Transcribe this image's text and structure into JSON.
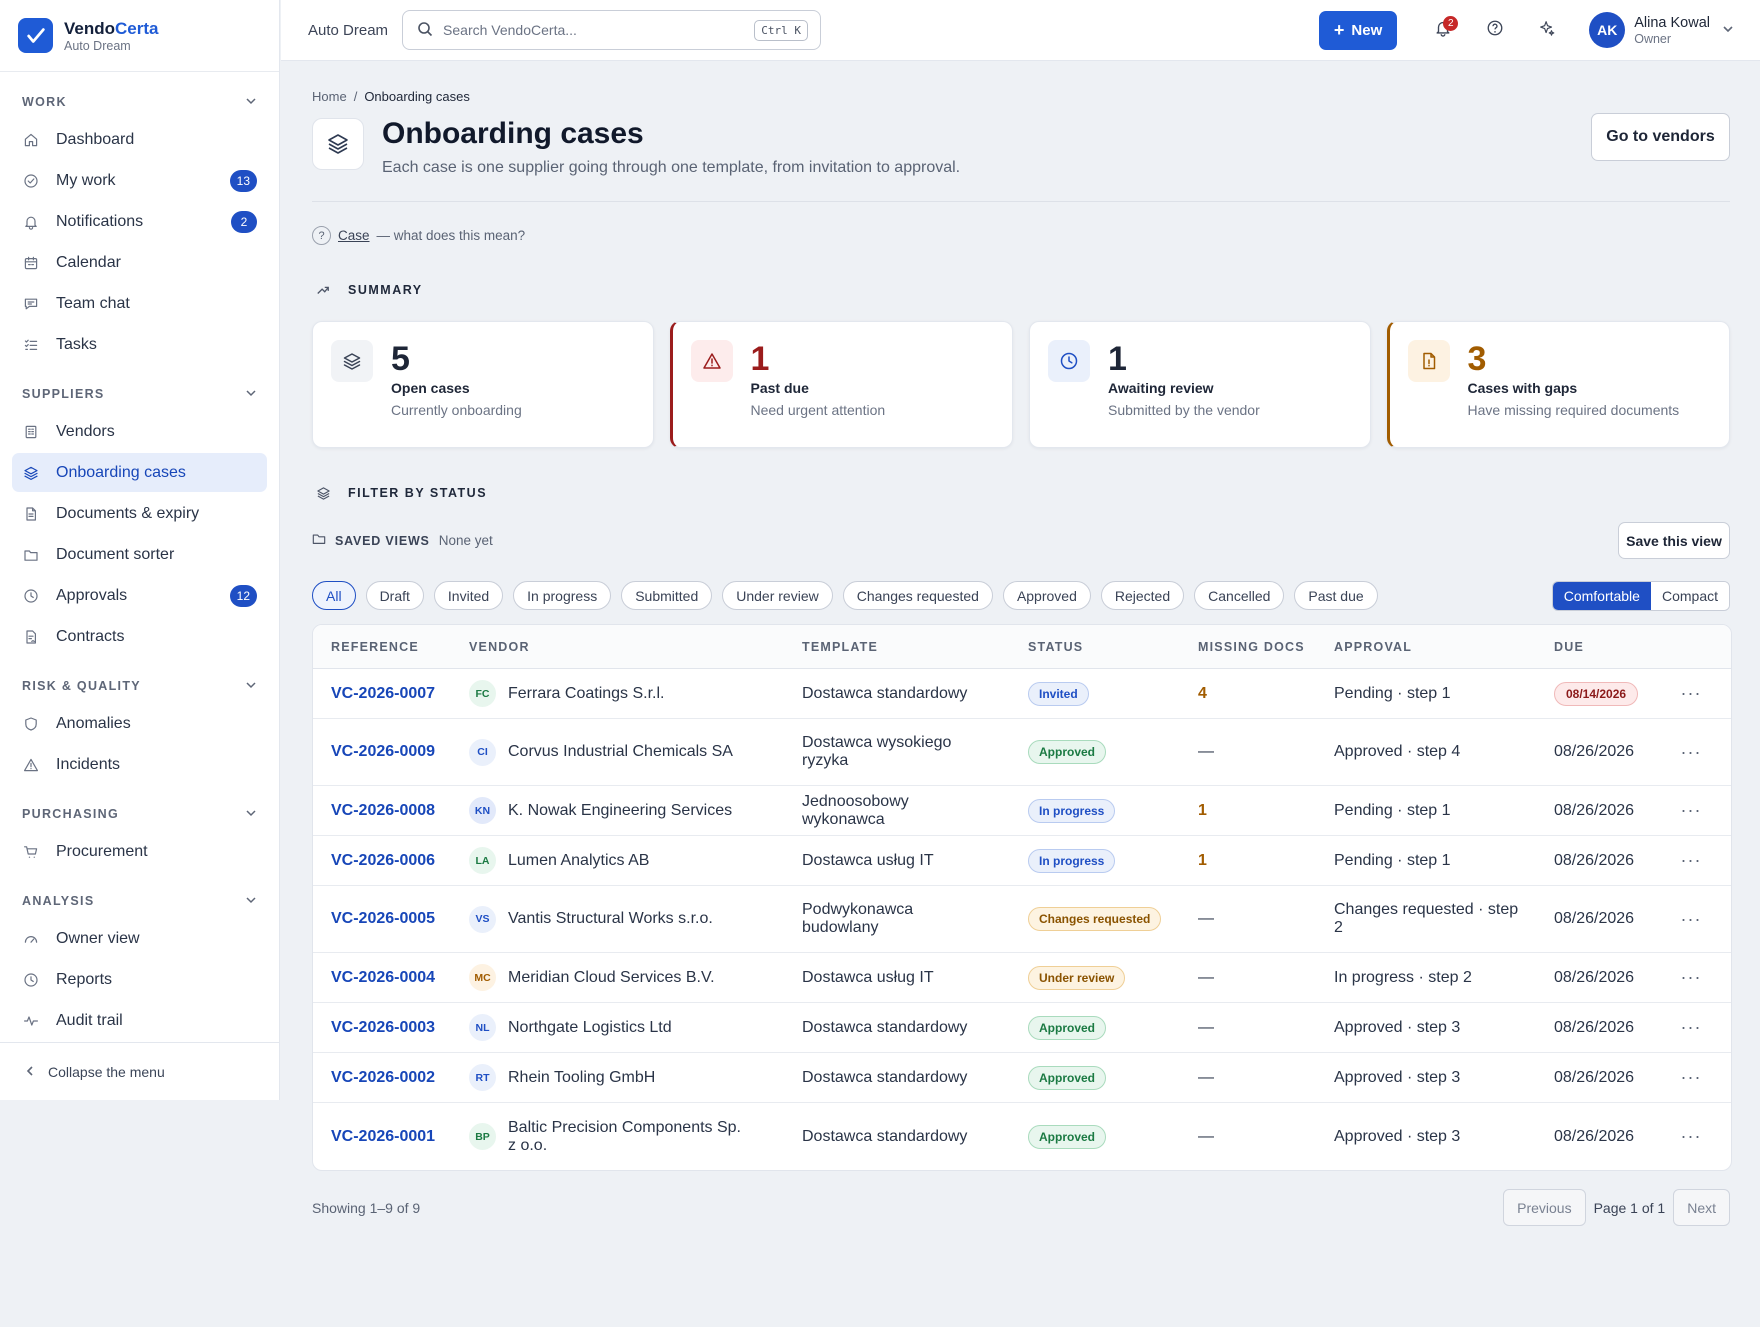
{
  "brand": {
    "name_a": "Vendo",
    "name_b": "Certa",
    "org": "Auto Dream"
  },
  "colors": {
    "accent": "#1f5bd6",
    "danger": "#9b1c1c",
    "warning": "#a15c00",
    "approved": "#1b7a43"
  },
  "sidebar": {
    "sections": [
      {
        "title": "WORK",
        "items": [
          {
            "label": "Dashboard",
            "icon": "home-icon",
            "badge": ""
          },
          {
            "label": "My work",
            "icon": "check-circle-icon",
            "badge": "13"
          },
          {
            "label": "Notifications",
            "icon": "bell-icon",
            "badge": "2"
          },
          {
            "label": "Calendar",
            "icon": "calendar-icon",
            "badge": ""
          },
          {
            "label": "Team chat",
            "icon": "chat-icon",
            "badge": ""
          },
          {
            "label": "Tasks",
            "icon": "list-check-icon",
            "badge": ""
          }
        ]
      },
      {
        "title": "SUPPLIERS",
        "items": [
          {
            "label": "Vendors",
            "icon": "building-icon",
            "badge": ""
          },
          {
            "label": "Onboarding cases",
            "icon": "layers-icon",
            "badge": "",
            "active": true
          },
          {
            "label": "Documents & expiry",
            "icon": "document-icon",
            "badge": ""
          },
          {
            "label": "Document sorter",
            "icon": "folder-icon",
            "badge": ""
          },
          {
            "label": "Approvals",
            "icon": "clock-icon",
            "badge": "12"
          },
          {
            "label": "Contracts",
            "icon": "contract-icon",
            "badge": ""
          }
        ]
      },
      {
        "title": "RISK & QUALITY",
        "items": [
          {
            "label": "Anomalies",
            "icon": "shield-icon",
            "badge": ""
          },
          {
            "label": "Incidents",
            "icon": "warning-icon",
            "badge": ""
          }
        ]
      },
      {
        "title": "PURCHASING",
        "items": [
          {
            "label": "Procurement",
            "icon": "cart-icon",
            "badge": ""
          }
        ]
      },
      {
        "title": "ANALYSIS",
        "items": [
          {
            "label": "Owner view",
            "icon": "gauge-icon",
            "badge": ""
          },
          {
            "label": "Reports",
            "icon": "clock-icon",
            "badge": ""
          },
          {
            "label": "Audit trail",
            "icon": "activity-icon",
            "badge": ""
          }
        ]
      }
    ],
    "collapse_label": "Collapse the menu"
  },
  "topbar": {
    "org": "Auto Dream",
    "search_placeholder": "Search VendoCerta...",
    "search_shortcut": "Ctrl K",
    "new_label": "New",
    "notif_count": "2",
    "user_initials": "AK",
    "user_name": "Alina Kowal",
    "user_role": "Owner"
  },
  "page": {
    "breadcrumb_home": "Home",
    "breadcrumb_sep": "/",
    "breadcrumb_current": "Onboarding cases",
    "title": "Onboarding cases",
    "subtitle": "Each case is one supplier going through one template, from invitation to approval.",
    "go_vendors": "Go to vendors",
    "term_word": "Case",
    "term_hint": "— what does this mean?"
  },
  "summary": {
    "heading": "SUMMARY",
    "cards": [
      {
        "value": "5",
        "label": "Open cases",
        "desc": "Currently onboarding",
        "icon": "layers-icon",
        "color": "#1e2637",
        "icon_bg": "#f1f3f6"
      },
      {
        "value": "1",
        "label": "Past due",
        "desc": "Need urgent attention",
        "icon": "warning-icon",
        "color": "#9b1c1c",
        "icon_bg": "#fdecec"
      },
      {
        "value": "1",
        "label": "Awaiting review",
        "desc": "Submitted by the vendor",
        "icon": "clock-icon",
        "color": "#1e2637",
        "icon_bg": "#eaf0fb"
      },
      {
        "value": "3",
        "label": "Cases with gaps",
        "desc": "Have missing required documents",
        "icon": "document-alert-icon",
        "color": "#a15c00",
        "icon_bg": "#fdf2e2"
      }
    ]
  },
  "filter": {
    "heading": "FILTER BY STATUS",
    "saved_label": "SAVED VIEWS",
    "saved_value": "None yet",
    "save_btn": "Save this view",
    "chips": [
      "All",
      "Draft",
      "Invited",
      "In progress",
      "Submitted",
      "Under review",
      "Changes requested",
      "Approved",
      "Rejected",
      "Cancelled",
      "Past due"
    ],
    "active_chip": "All",
    "density": [
      "Comfortable",
      "Compact"
    ],
    "density_active": "Comfortable"
  },
  "table": {
    "headers": [
      "REFERENCE",
      "VENDOR",
      "TEMPLATE",
      "STATUS",
      "MISSING DOCS",
      "APPROVAL",
      "DUE"
    ],
    "rows": [
      {
        "ref": "VC-2026-0007",
        "initials": "FC",
        "vendor": "Ferrara Coatings S.r.l.",
        "template": "Dostawca standardowy",
        "status": "Invited",
        "missing": "4",
        "approval": "Pending · step 1",
        "due": "08/14/2026",
        "due_overdue": true
      },
      {
        "ref": "VC-2026-0009",
        "initials": "CI",
        "vendor": "Corvus Industrial Chemicals SA",
        "template": "Dostawca wysokiego ryzyka",
        "status": "Approved",
        "missing": "—",
        "approval": "Approved · step 4",
        "due": "08/26/2026"
      },
      {
        "ref": "VC-2026-0008",
        "initials": "KN",
        "vendor": "K. Nowak Engineering Services",
        "template": "Jednoosobowy wykonawca",
        "status": "In progress",
        "missing": "1",
        "approval": "Pending · step 1",
        "due": "08/26/2026"
      },
      {
        "ref": "VC-2026-0006",
        "initials": "LA",
        "vendor": "Lumen Analytics AB",
        "template": "Dostawca usług IT",
        "status": "In progress",
        "missing": "1",
        "approval": "Pending · step 1",
        "due": "08/26/2026"
      },
      {
        "ref": "VC-2026-0005",
        "initials": "VS",
        "vendor": "Vantis Structural Works s.r.o.",
        "template": "Podwykonawca budowlany",
        "status": "Changes requested",
        "missing": "—",
        "approval": "Changes requested · step 2",
        "due": "08/26/2026"
      },
      {
        "ref": "VC-2026-0004",
        "initials": "MC",
        "vendor": "Meridian Cloud Services B.V.",
        "template": "Dostawca usług IT",
        "status": "Under review",
        "missing": "—",
        "approval": "In progress · step 2",
        "due": "08/26/2026"
      },
      {
        "ref": "VC-2026-0003",
        "initials": "NL",
        "vendor": "Northgate Logistics Ltd",
        "template": "Dostawca standardowy",
        "status": "Approved",
        "missing": "—",
        "approval": "Approved · step 3",
        "due": "08/26/2026"
      },
      {
        "ref": "VC-2026-0002",
        "initials": "RT",
        "vendor": "Rhein Tooling GmbH",
        "template": "Dostawca standardowy",
        "status": "Approved",
        "missing": "—",
        "approval": "Approved · step 3",
        "due": "08/26/2026"
      },
      {
        "ref": "VC-2026-0001",
        "initials": "BP",
        "vendor": "Baltic Precision Components Sp. z o.o.",
        "template": "Dostawca standardowy",
        "status": "Approved",
        "missing": "—",
        "approval": "Approved · step 3",
        "due": "08/26/2026"
      }
    ],
    "showing": "Showing 1–9 of 9",
    "prev": "Previous",
    "page_text": "Page 1 of 1",
    "next": "Next"
  }
}
